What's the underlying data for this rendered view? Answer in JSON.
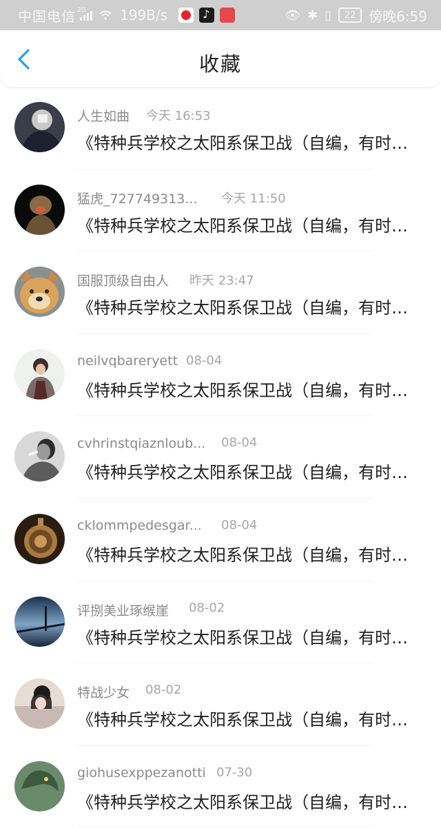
{
  "status_bar": {
    "carrier": "中国电信",
    "network_tag": "2G",
    "speed": "199B/s",
    "battery": "22",
    "time": "傍晚6:59"
  },
  "header": {
    "title": "收藏",
    "back_icon": "chevron-left-icon"
  },
  "colors": {
    "accent": "#2a9ee2",
    "status_bar_bg": "#cfcfcf"
  },
  "items": [
    {
      "name": "人生如曲",
      "time": "今天 16:53",
      "title": "《特种兵学校之太阳系保卫战（自编，有时更新慢）》"
    },
    {
      "name": "猛虎_727749313...",
      "time": "今天 11:50",
      "title": "《特种兵学校之太阳系保卫战（自编，有时更新慢）》"
    },
    {
      "name": "国服顶级自由人",
      "time": "昨天 23:47",
      "title": "《特种兵学校之太阳系保卫战（自编，有时更新慢）》"
    },
    {
      "name": "neilvqbareryett",
      "time": "08-04",
      "title": "《特种兵学校之太阳系保卫战（自编，有时更新慢）》"
    },
    {
      "name": "cvhrinstqiaznloub...",
      "time": "08-04",
      "title": "《特种兵学校之太阳系保卫战（自编，有时更新慢）》"
    },
    {
      "name": "cklommpedesgar...",
      "time": "08-04",
      "title": "《特种兵学校之太阳系保卫战（自编，有时更新慢）》"
    },
    {
      "name": "评捌美业琢缑崖",
      "time": "08-02",
      "title": "《特种兵学校之太阳系保卫战（自编，有时更新慢）》"
    },
    {
      "name": "特战少女",
      "time": "08-02",
      "title": "《特种兵学校之太阳系保卫战（自编，有时更新慢）》"
    },
    {
      "name": "giohusexppezanotti",
      "time": "07-30",
      "title": "《特种兵学校之太阳系保卫战（自编，有时更新慢）》"
    }
  ]
}
